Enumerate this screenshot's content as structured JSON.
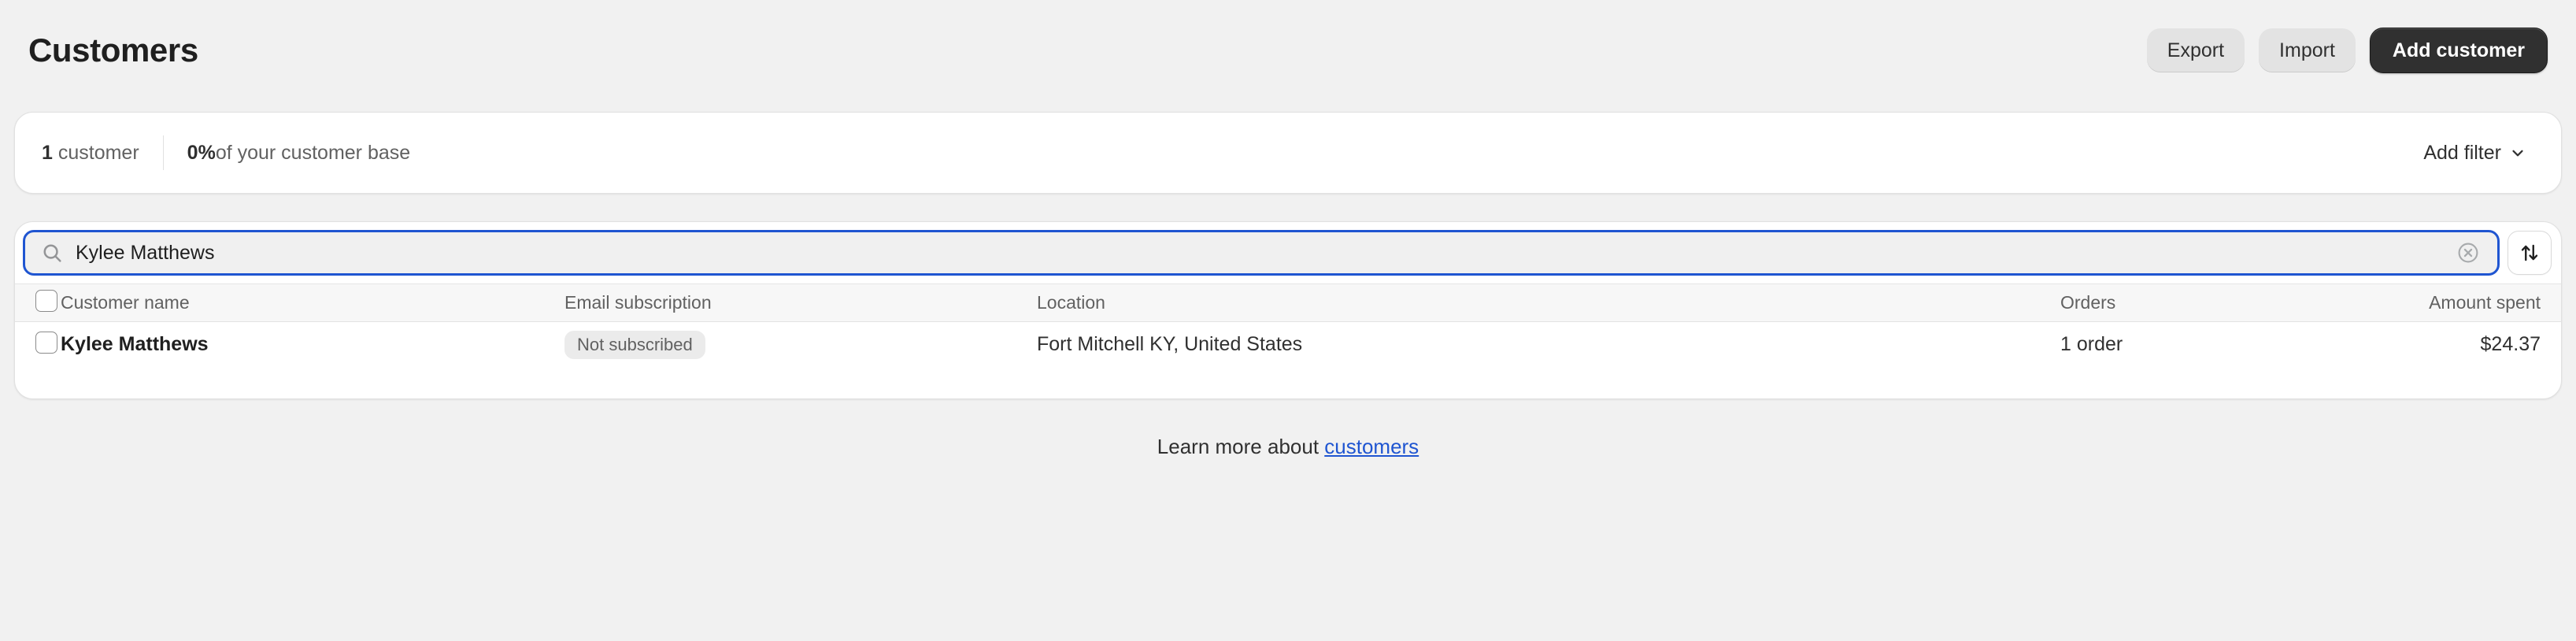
{
  "header": {
    "title": "Customers",
    "actions": [
      {
        "label": "Export",
        "variant": "secondary"
      },
      {
        "label": "Import",
        "variant": "secondary"
      },
      {
        "label": "Add customer",
        "variant": "primary"
      }
    ]
  },
  "summary": {
    "count_value": "1",
    "count_label": " customer",
    "percent_value": "0%",
    "percent_label": " of your customer base",
    "add_filter_label": "Add filter"
  },
  "search": {
    "value": "Kylee Matthews",
    "placeholder": "Search customers",
    "search_icon": "search-icon",
    "clear_icon": "clear-circle-icon",
    "sort_icon": "sort-arrows-icon"
  },
  "table": {
    "columns": [
      "Customer name",
      "Email subscription",
      "Location",
      "Orders",
      "Amount spent"
    ],
    "rows": [
      {
        "name": "Kylee Matthews",
        "email_subscription": "Not subscribed",
        "location": "Fort Mitchell KY, United States",
        "orders": "1 order",
        "amount_spent": "$24.37"
      }
    ]
  },
  "footer": {
    "text": "Learn more about ",
    "link": "customers"
  },
  "colors": {
    "page_background": "#f1f1f1",
    "card_background": "#ffffff",
    "primary_button": "#303030",
    "secondary_button": "#e3e3e3",
    "focus_ring": "#1f55d1",
    "link": "#1f55d1",
    "badge_background": "#ebebeb",
    "muted_text": "#616161"
  }
}
